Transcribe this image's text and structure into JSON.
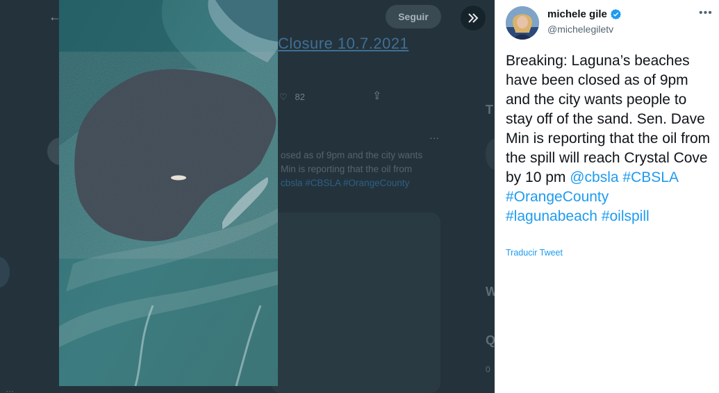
{
  "background": {
    "follow_label": "Seguir",
    "tweet_title_fragment": "Closure 10.7.2021",
    "like_count": "82",
    "text_lines": [
      "osed as of 9pm and the city wants",
      "Min is reporting that the oil from"
    ],
    "tags_line": "cbsla #CBSLA #OrangeCounty"
  },
  "tweet": {
    "author_name": "michele gile",
    "verified": true,
    "handle": "@michelegiletv",
    "text_plain": "Breaking: Laguna’s beaches have been closed as of 9pm and the city wants people to stay off of the sand. Sen. Dave Min is reporting that the oil from the spill will reach Crystal Cove by 10 pm ",
    "mention": "@cbsla",
    "hashtags": [
      "#CBSLA",
      "#OrangeCounty",
      "#lagunabeach",
      "#oilspill"
    ],
    "translate_label": "Traducir Tweet"
  },
  "colors": {
    "link": "#1d9bf0",
    "verified": "#1d9bf0",
    "overlay": "#24333b"
  },
  "icons": {
    "expand": "chevron-double-right-icon",
    "more": "more-horizontal-icon",
    "verified": "verified-badge-icon"
  }
}
